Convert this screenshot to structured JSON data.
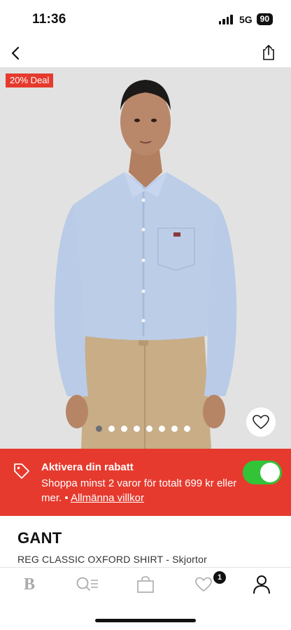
{
  "status": {
    "time": "11:36",
    "network": "5G",
    "battery": "90"
  },
  "product": {
    "deal_badge": "20% Deal",
    "image_dots": {
      "count": 8,
      "active_index": 0
    },
    "brand": "GANT",
    "name": "REG CLASSIC OXFORD SHIRT - Skjortor"
  },
  "promo": {
    "title": "Aktivera din rabatt",
    "text": "Shoppa minst 2 varor för totalt  699 kr eller mer. •",
    "link": "Allmänna villkor",
    "toggle_on": true
  },
  "tab_bar": {
    "wishlist_count": "1"
  },
  "colors": {
    "deal_red": "#e63a2e",
    "toggle_green": "#33c338",
    "hero_bg": "#e2e2e2"
  }
}
